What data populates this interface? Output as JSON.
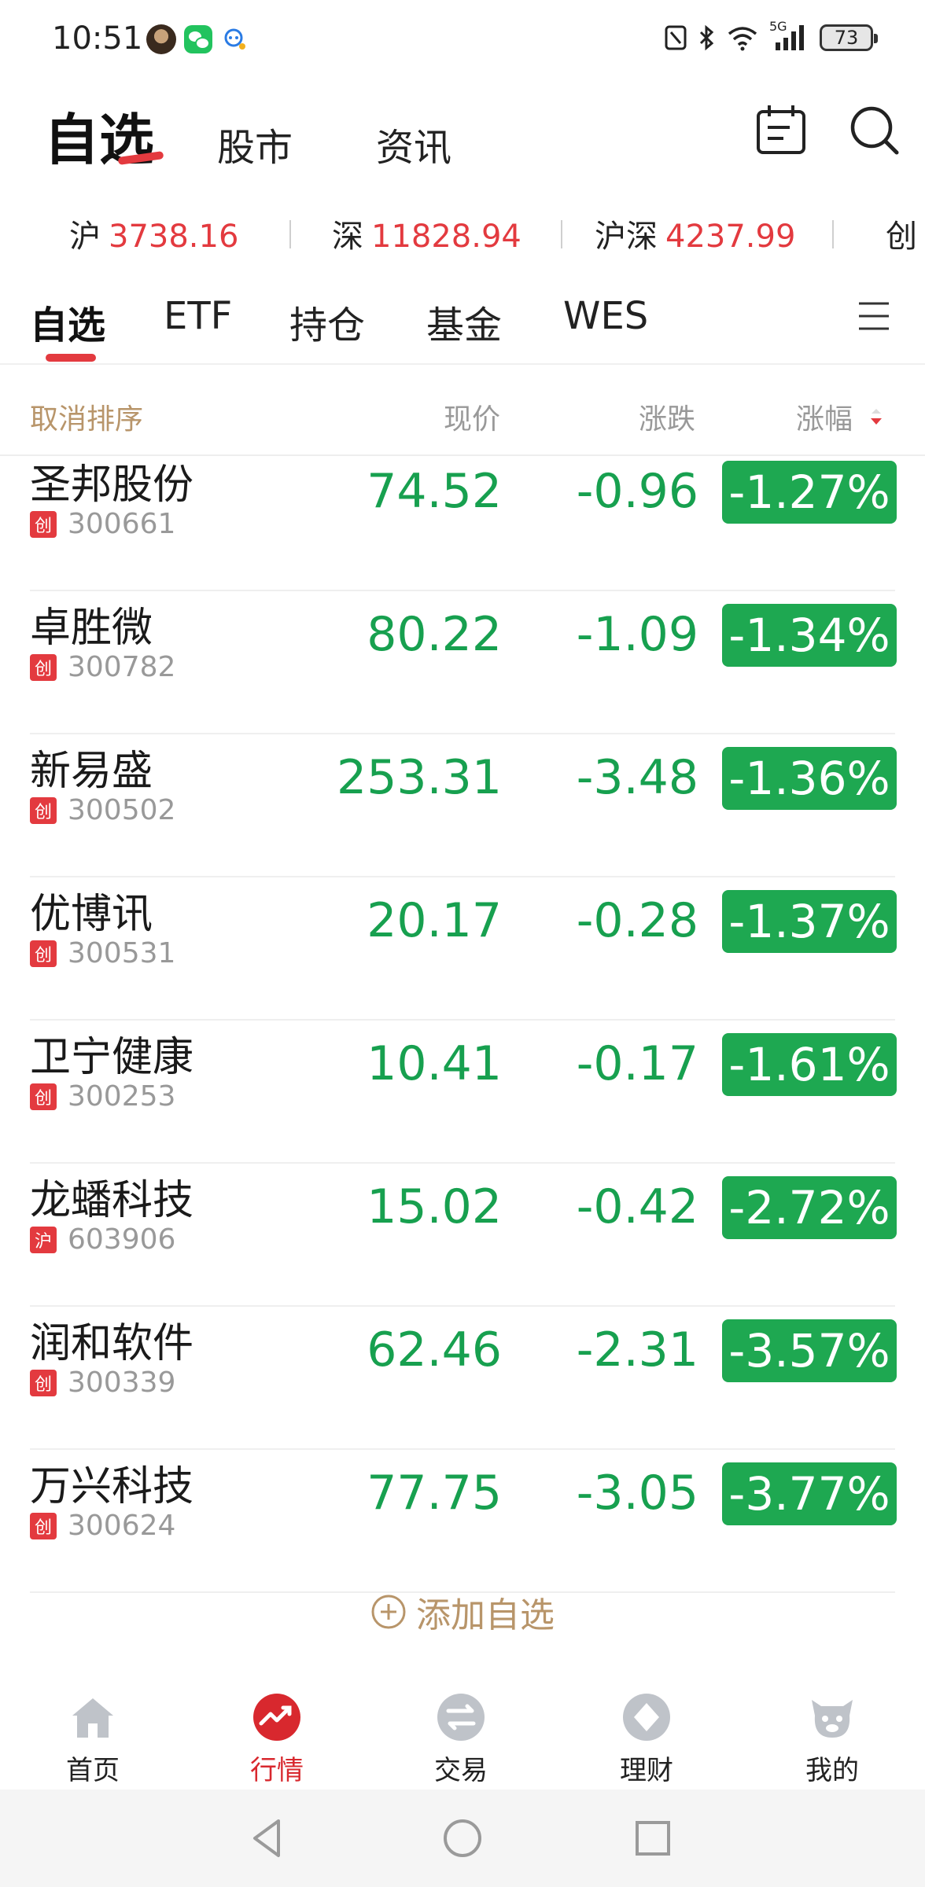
{
  "status_bar": {
    "time": "10:51",
    "network": "5G",
    "battery": "73"
  },
  "header": {
    "title": "自选",
    "tabs": [
      "股市",
      "资讯"
    ]
  },
  "indices": [
    {
      "name": "沪",
      "value": "3738.16"
    },
    {
      "name": "深",
      "value": "11828.94"
    },
    {
      "name": "沪深",
      "value": "4237.99"
    },
    {
      "name": "创",
      "value": ""
    }
  ],
  "categories": {
    "items": [
      "自选",
      "ETF",
      "持仓",
      "基金",
      "WES"
    ],
    "active": "自选"
  },
  "columns": {
    "cancel_sort": "取消排序",
    "price": "现价",
    "change": "涨跌",
    "percent": "涨幅"
  },
  "stocks": [
    {
      "name": "圣邦股份",
      "market": "创",
      "code": "300661",
      "price": "74.52",
      "change": "-0.96",
      "percent": "-1.27%"
    },
    {
      "name": "卓胜微",
      "market": "创",
      "code": "300782",
      "price": "80.22",
      "change": "-1.09",
      "percent": "-1.34%"
    },
    {
      "name": "新易盛",
      "market": "创",
      "code": "300502",
      "price": "253.31",
      "change": "-3.48",
      "percent": "-1.36%"
    },
    {
      "name": "优博讯",
      "market": "创",
      "code": "300531",
      "price": "20.17",
      "change": "-0.28",
      "percent": "-1.37%"
    },
    {
      "name": "卫宁健康",
      "market": "创",
      "code": "300253",
      "price": "10.41",
      "change": "-0.17",
      "percent": "-1.61%"
    },
    {
      "name": "龙蟠科技",
      "market": "沪",
      "code": "603906",
      "price": "15.02",
      "change": "-0.42",
      "percent": "-2.72%"
    },
    {
      "name": "润和软件",
      "market": "创",
      "code": "300339",
      "price": "62.46",
      "change": "-2.31",
      "percent": "-3.57%"
    },
    {
      "name": "万兴科技",
      "market": "创",
      "code": "300624",
      "price": "77.75",
      "change": "-3.05",
      "percent": "-3.77%"
    }
  ],
  "add_watchlist": "添加自选",
  "bottom_nav": [
    {
      "label": "首页",
      "icon": "home-icon"
    },
    {
      "label": "行情",
      "icon": "market-icon",
      "active": true
    },
    {
      "label": "交易",
      "icon": "trade-icon"
    },
    {
      "label": "理财",
      "icon": "wealth-icon"
    },
    {
      "label": "我的",
      "icon": "profile-icon"
    }
  ],
  "colors": {
    "up_red": "#e33a3f",
    "down_green": "#1ea851",
    "accent_gold": "#b8956a"
  }
}
